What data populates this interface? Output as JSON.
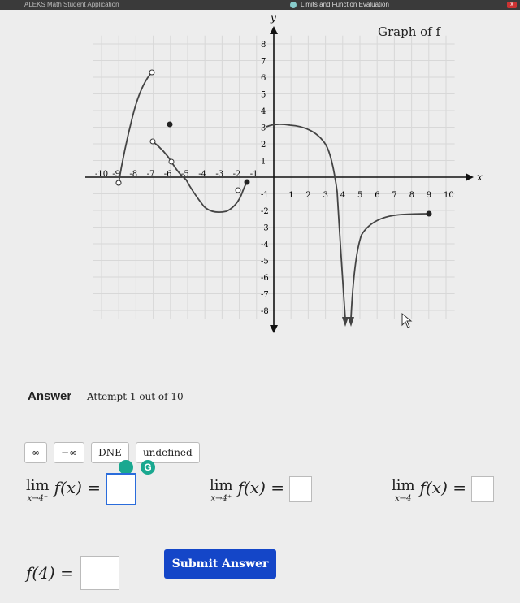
{
  "topbar": {
    "app_title": "ALEKS Math Student Application",
    "window_title": "Limits and Function Evaluation",
    "close_label": "x"
  },
  "graph": {
    "title": "Graph of f",
    "x_axis_label": "x",
    "y_axis_label": "y",
    "x_tick_labels": [
      "-10",
      "-9",
      "-8",
      "-7",
      "-6",
      "-5",
      "-4",
      "-3",
      "-2",
      "-1",
      "1",
      "2",
      "3",
      "4",
      "5",
      "6",
      "7",
      "8",
      "9",
      "10"
    ],
    "y_tick_labels": [
      "8",
      "7",
      "6",
      "5",
      "4",
      "3",
      "2",
      "1",
      "-1",
      "-2",
      "-3",
      "-4",
      "-5",
      "-6",
      "-7",
      "-8"
    ],
    "colors": {
      "curve": "#444444",
      "grid": "#d8d8d8",
      "axis": "#111111"
    }
  },
  "answer": {
    "heading": "Answer",
    "attempt": "Attempt 1 out of 10",
    "chips": [
      "∞",
      "−∞",
      "DNE",
      "undefined"
    ],
    "limit_left": {
      "word": "lim",
      "sub": "x→4⁻",
      "expr": "f(x) ="
    },
    "limit_right": {
      "word": "lim",
      "sub": "x→4⁺",
      "expr": "f(x) ="
    },
    "limit_both": {
      "word": "lim",
      "sub": "x→4",
      "expr": "f(x) ="
    },
    "value_expr": "f(4) =",
    "submit_label": "Submit Answer"
  }
}
